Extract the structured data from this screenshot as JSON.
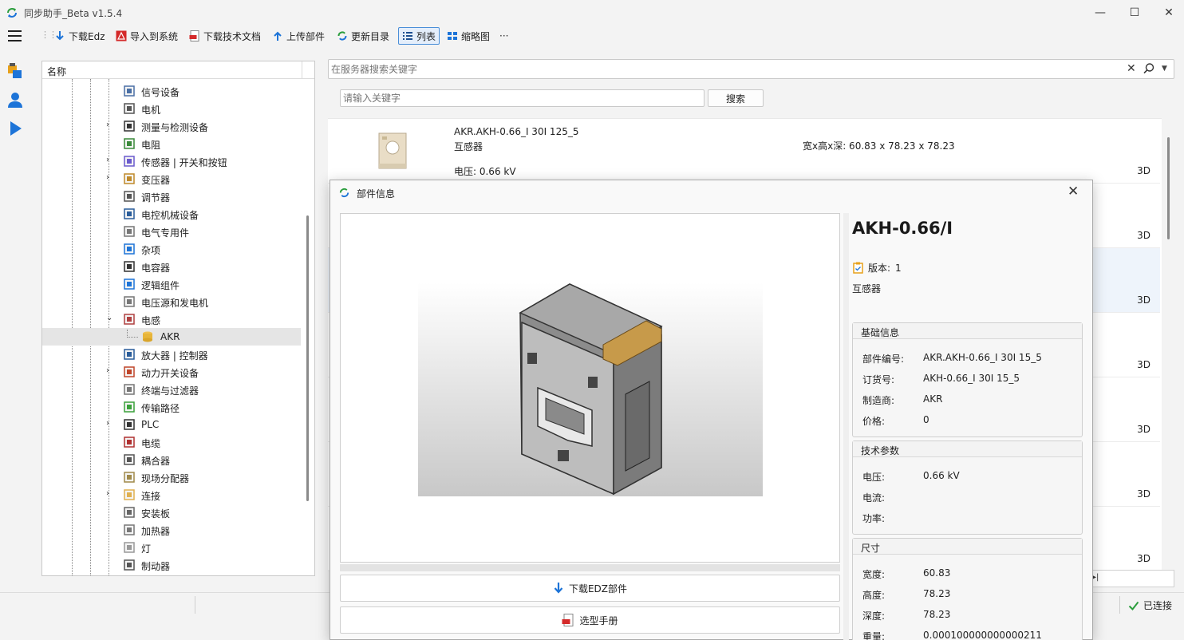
{
  "window": {
    "title": "同步助手_Beta v1.5.4",
    "min": "—",
    "max": "☐",
    "close": "✕"
  },
  "toolbar": {
    "download_edz": "下载Edz",
    "import_system": "导入到系统",
    "download_docs": "下载技术文档",
    "upload_part": "上传部件",
    "update_catalog": "更新目录",
    "list_view": "列表",
    "thumb_view": "缩略图",
    "more": "···"
  },
  "tree": {
    "header": "名称",
    "items": [
      {
        "label": "信号设备",
        "exp": ""
      },
      {
        "label": "电机",
        "exp": ""
      },
      {
        "label": "测量与检测设备",
        "exp": "›"
      },
      {
        "label": "电阻",
        "exp": ""
      },
      {
        "label": "传感器 | 开关和按钮",
        "exp": "›"
      },
      {
        "label": "变压器",
        "exp": "›"
      },
      {
        "label": "调节器",
        "exp": ""
      },
      {
        "label": "电控机械设备",
        "exp": ""
      },
      {
        "label": "电气专用件",
        "exp": ""
      },
      {
        "label": "杂项",
        "exp": ""
      },
      {
        "label": "电容器",
        "exp": ""
      },
      {
        "label": "逻辑组件",
        "exp": ""
      },
      {
        "label": "电压源和发电机",
        "exp": ""
      },
      {
        "label": "电感",
        "exp": "⌄"
      },
      {
        "label": "AKR",
        "exp": ""
      },
      {
        "label": "放大器 | 控制器",
        "exp": ""
      },
      {
        "label": "动力开关设备",
        "exp": "›"
      },
      {
        "label": "终端与过滤器",
        "exp": ""
      },
      {
        "label": "传输路径",
        "exp": ""
      },
      {
        "label": "PLC",
        "exp": "›"
      },
      {
        "label": "电缆",
        "exp": ""
      },
      {
        "label": "耦合器",
        "exp": ""
      },
      {
        "label": "现场分配器",
        "exp": ""
      },
      {
        "label": "连接",
        "exp": "›"
      },
      {
        "label": "安装板",
        "exp": ""
      },
      {
        "label": "加热器",
        "exp": ""
      },
      {
        "label": "灯",
        "exp": ""
      },
      {
        "label": "制动器",
        "exp": ""
      }
    ]
  },
  "search": {
    "server_placeholder": "在服务器搜索关键字",
    "keyword_placeholder": "请输入关键字",
    "search_button": "搜索",
    "clear_icon": "✕"
  },
  "list": {
    "row1": {
      "title": "AKR.AKH-0.66_I 30I 125_5",
      "type": "互感器",
      "voltage": "电压: 0.66 kV",
      "dims": "宽x高x深: 60.83 x 78.23 x 78.23",
      "tag": "3D"
    },
    "tags": [
      "3D",
      "3D",
      "3D",
      "3D",
      "3D",
      "3D"
    ]
  },
  "pager": {
    "last": "▸|"
  },
  "status": {
    "connected": "已连接"
  },
  "dialog": {
    "title": "部件信息",
    "name": "AKH-0.66/I",
    "version_label": "版本:",
    "version": "1",
    "type": "互感器",
    "download_edz": "下载EDZ部件",
    "manual": "选型手册",
    "basic": {
      "title": "基础信息",
      "part_no_k": "部件编号:",
      "part_no_v": "AKR.AKH-0.66_I 30I 15_5",
      "order_k": "订货号:",
      "order_v": "AKH-0.66_I 30I 15_5",
      "maker_k": "制造商:",
      "maker_v": "AKR",
      "price_k": "价格:",
      "price_v": "0"
    },
    "tech": {
      "title": "技术参数",
      "voltage_k": "电压:",
      "voltage_v": "0.66 kV",
      "current_k": "电流:",
      "current_v": "",
      "power_k": "功率:",
      "power_v": ""
    },
    "size": {
      "title": "尺寸",
      "width_k": "宽度:",
      "width_v": "60.83",
      "height_k": "高度:",
      "height_v": "78.23",
      "depth_k": "深度:",
      "depth_v": "78.23",
      "weight_k": "重量:",
      "weight_v": "0.000100000000000211"
    }
  }
}
